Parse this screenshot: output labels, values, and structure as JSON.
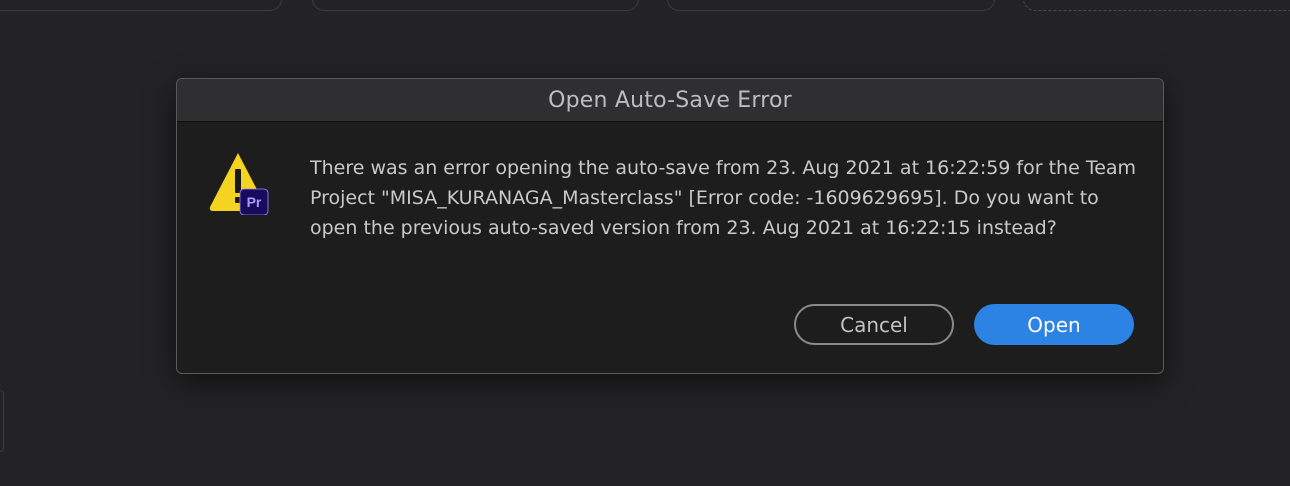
{
  "dialog": {
    "title": "Open Auto-Save Error",
    "message": "There was an error opening the auto-save from 23. Aug 2021 at 16:22:59 for the Team Project \"MISA_KURANAGA_Masterclass\" [Error code: -1609629695]. Do you want to open the previous auto-saved version from 23. Aug 2021 at 16:22:15 instead?",
    "icon": {
      "name": "warning-icon",
      "badge_text": "Pr",
      "triangle_color": "#f5d321",
      "badge_color": "#1a0a5e",
      "badge_text_color": "#a79bff"
    },
    "buttons": {
      "cancel_label": "Cancel",
      "open_label": "Open"
    },
    "colors": {
      "primary_button": "#2c83e4",
      "background": "#1d1d1d",
      "titlebar": "#2f2f31"
    }
  }
}
